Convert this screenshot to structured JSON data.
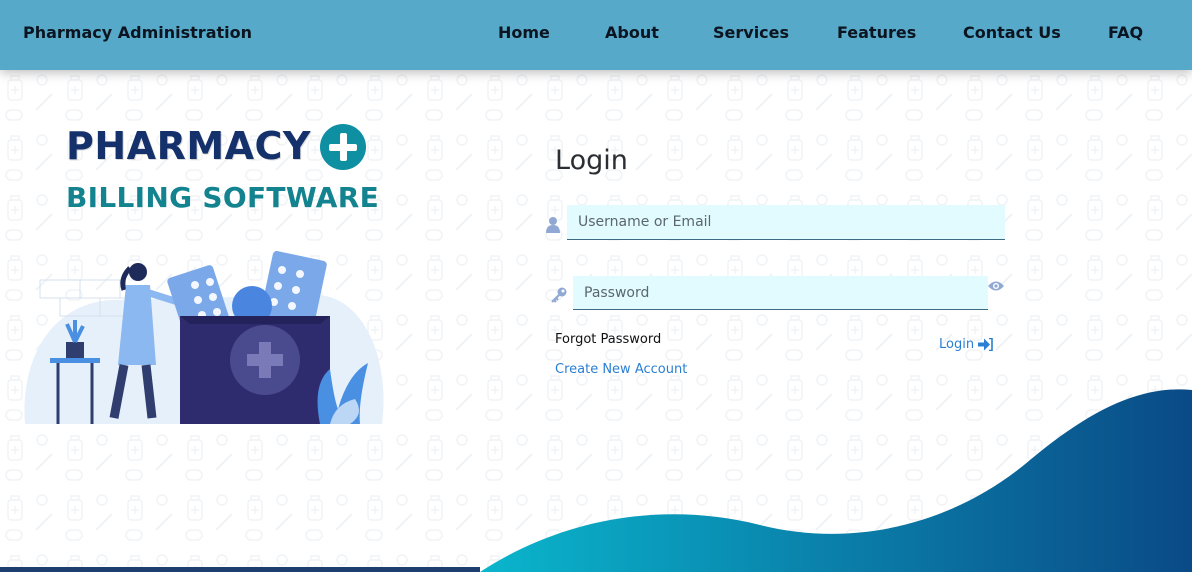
{
  "header": {
    "brand": "Pharmacy Administration",
    "nav": [
      {
        "label": "Home"
      },
      {
        "label": "About"
      },
      {
        "label": "Services"
      },
      {
        "label": "Features"
      },
      {
        "label": "Contact Us"
      },
      {
        "label": "FAQ"
      }
    ]
  },
  "logo": {
    "title": "PHARMACY",
    "subtitle": "BILLING SOFTWARE"
  },
  "login": {
    "title": "Login",
    "username_placeholder": "Username or Email",
    "password_placeholder": "Password",
    "forgot_label": "Forgot Password",
    "create_label": "Create New Account",
    "submit_label": "Login"
  },
  "icons": {
    "user": "user-icon",
    "key": "key-icon",
    "eye": "eye-icon",
    "sign_in": "sign-in-icon",
    "plus": "plus-circle-icon"
  },
  "colors": {
    "navbar": "#56a9c8",
    "input_bg": "#e2fbff",
    "link": "#2a7fd4",
    "logo_title": "#14316b",
    "logo_sub": "#12838f",
    "wave_start": "#0ab5cc",
    "wave_end": "#0a4a86"
  }
}
